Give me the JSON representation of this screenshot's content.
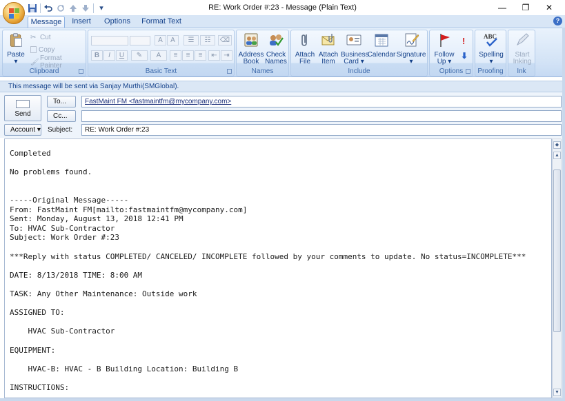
{
  "window": {
    "title": "RE: Work Order #:23 - Message (Plain Text)",
    "minimize": "—",
    "restore": "❐",
    "close": "✕"
  },
  "quick_access": {
    "save_icon": "save-icon",
    "undo_icon": "undo-icon",
    "redo_icon": "redo-icon",
    "customize": "▾"
  },
  "tabs": [
    "Message",
    "Insert",
    "Options",
    "Format Text"
  ],
  "help_glyph": "?",
  "ribbon": {
    "clipboard": {
      "label": "Clipboard",
      "paste": "Paste",
      "cut": "Cut",
      "copy": "Copy",
      "format_painter": "Format Painter"
    },
    "basic_text": {
      "label": "Basic Text"
    },
    "names": {
      "label": "Names",
      "address_book": [
        "Address",
        "Book"
      ],
      "check_names": [
        "Check",
        "Names"
      ]
    },
    "include": {
      "label": "Include",
      "attach_file": [
        "Attach",
        "File"
      ],
      "attach_item": [
        "Attach",
        "Item"
      ],
      "business_card": [
        "Business",
        "Card ▾"
      ],
      "calendar": "Calendar",
      "signature": [
        "Signature",
        "▾"
      ]
    },
    "options": {
      "label": "Options",
      "follow_up": [
        "Follow",
        "Up ▾"
      ]
    },
    "proofing": {
      "label": "Proofing",
      "spelling": [
        "Spelling",
        "▾"
      ]
    },
    "ink": {
      "label": "Ink",
      "start_inking": [
        "Start",
        "Inking"
      ]
    }
  },
  "info_bar": "This message will be sent via Sanjay Murthi(SMGlobal).",
  "header": {
    "send": "Send",
    "to_button": "To...",
    "cc_button": "Cc...",
    "account_button": "Account ▾",
    "subject_label": "Subject:",
    "to_value": "FastMaint FM <fastmaintfm@mycompany.com>",
    "cc_value": "",
    "subject_value": "RE: Work Order #:23"
  },
  "body_lines": [
    "Completed",
    "",
    "No problems found.",
    "",
    "",
    "-----Original Message-----",
    "From: FastMaint FM[mailto:fastmaintfm@mycompany.com]",
    "Sent: Monday, August 13, 2018 12:41 PM",
    "To: HVAC Sub-Contractor",
    "Subject: Work Order #:23",
    "",
    "***Reply with status COMPLETED/ CANCELED/ INCOMPLETE followed by your comments to update. No status=INCOMPLETE***",
    "",
    "DATE: 8/13/2018 TIME: 8:00 AM",
    "",
    "TASK: Any Other Maintenance: Outside work",
    "",
    "ASSIGNED TO:",
    "",
    "    HVAC Sub-Contractor",
    "",
    "EQUIPMENT:",
    "",
    "    HVAC-B: HVAC - B Building Location: Building B",
    "",
    "INSTRUCTIONS:"
  ],
  "colors": {
    "ribbon_text": "#15428b",
    "follow_up_flag": "#d21d1d",
    "importance_high": "#d21d1d",
    "importance_low": "#2a62c9"
  }
}
